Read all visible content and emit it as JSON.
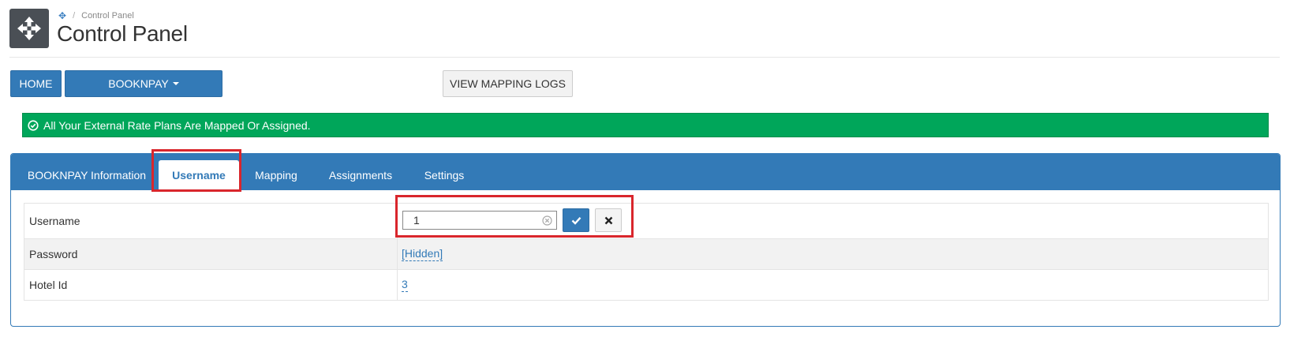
{
  "header": {
    "breadcrumb": "Control Panel",
    "title": "Control Panel",
    "app_icon": "move-arrows-icon"
  },
  "toolbar": {
    "home_label": "HOME",
    "booknpay_label": "BOOKNPAY",
    "mapping_logs_label": "VIEW MAPPING LOGS"
  },
  "alert": {
    "icon": "check-circle-icon",
    "text": "All Your External Rate Plans Are Mapped Or Assigned.",
    "color": "#00a65a"
  },
  "tabs": [
    {
      "label": "BOOKNPAY Information",
      "active": false
    },
    {
      "label": "Username",
      "active": true
    },
    {
      "label": "Mapping",
      "active": false
    },
    {
      "label": "Assignments",
      "active": false
    },
    {
      "label": "Settings",
      "active": false
    }
  ],
  "table": {
    "rows": [
      {
        "label": "Username",
        "value": "1"
      },
      {
        "label": "Password",
        "value": "[Hidden]"
      },
      {
        "label": "Hotel Id",
        "value": "3"
      }
    ]
  },
  "colors": {
    "primary": "#337ab7",
    "highlight": "#d9262c"
  }
}
